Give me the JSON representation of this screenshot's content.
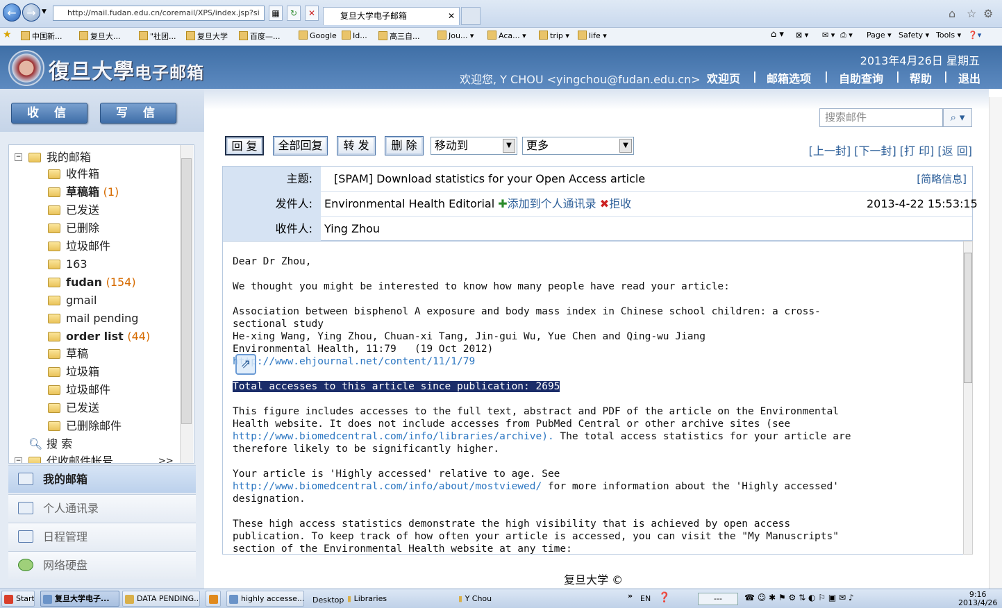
{
  "browser": {
    "address": "http://mail.fudan.edu.cn/coremail/XPS/index.jsp?si",
    "tab_title": "复旦大学电子邮箱",
    "favorites": [
      "中国新...",
      "复旦大...",
      "\"社团...",
      "复旦大学",
      "百度—...",
      "Google",
      "Id...",
      "高三自...",
      "Jou...",
      "Aca...",
      "trip",
      "life"
    ],
    "commands": [
      "Page",
      "Safety",
      "Tools"
    ]
  },
  "mail_header": {
    "logo_title": "復旦大學",
    "logo_sub": "电子邮箱",
    "date": "2013年4月26日 星期五",
    "welcome": "欢迎您, Y CHOU <yingchou@fudan.edu.cn>",
    "nav": [
      "欢迎页",
      "邮箱选项",
      "自助查询",
      "帮助",
      "退出"
    ]
  },
  "left": {
    "receive": "收 信",
    "compose": "写 信",
    "tree_root": "我的邮箱",
    "folders": [
      {
        "name": "收件箱",
        "count": ""
      },
      {
        "name": "草稿箱",
        "count": "(1)"
      },
      {
        "name": "已发送",
        "count": ""
      },
      {
        "name": "已删除",
        "count": ""
      },
      {
        "name": "垃圾邮件",
        "count": ""
      },
      {
        "name": "163",
        "count": ""
      },
      {
        "name": "fudan",
        "count": "(154)"
      },
      {
        "name": "gmail",
        "count": ""
      },
      {
        "name": "mail pending",
        "count": ""
      },
      {
        "name": "order list",
        "count": "(44)"
      },
      {
        "name": "草稿",
        "count": ""
      },
      {
        "name": "垃圾箱",
        "count": ""
      },
      {
        "name": "垃圾邮件",
        "count": ""
      },
      {
        "name": "已发送",
        "count": ""
      },
      {
        "name": "已删除邮件",
        "count": ""
      }
    ],
    "search": "搜 索",
    "proxy": "代收邮件帐号",
    "proxy_more": ">>",
    "modules": [
      "我的邮箱",
      "个人通讯录",
      "日程管理",
      "网络硬盘"
    ]
  },
  "toolbar": {
    "search_placeholder": "搜索邮件",
    "reply": "回 复",
    "reply_all": "全部回复",
    "forward": "转 发",
    "delete": "删 除",
    "move_to": "移动到",
    "more": "更多",
    "nav_links": "[上一封] [下一封] [打 印] [返 回]"
  },
  "message": {
    "subject_label": "主题:",
    "subject": "[SPAM] Download statistics for your Open Access article",
    "brief_info": "[简略信息]",
    "from_label": "发件人:",
    "from": "Environmental Health Editorial",
    "add_contact": "添加到个人通讯录",
    "reject": "拒收",
    "date": "2013-4-22 15:53:15",
    "to_label": "收件人:",
    "to": "Ying Zhou",
    "body": {
      "greeting": "Dear Dr Zhou,",
      "p1": "We thought you might be interested to know how many people have read your article:",
      "article_l1": "Association between bisphenol A exposure and body mass index in Chinese school children: a cross-",
      "article_l2": "sectional study",
      "authors": "He-xing Wang, Ying Zhou, Chuan-xi Tang, Jin-gui Wu, Yue Chen and Qing-wu Jiang",
      "journal": "Environmental Health, 11:79   (19 Oct 2012)",
      "url": "http://www.ehjournal.net/content/11/1/79",
      "total": "Total accesses to this article since publication: 2695",
      "p2_l1": "This figure includes accesses to the full text, abstract and PDF of the article on the Environmental",
      "p2_l2": "Health website. It does not include accesses from PubMed Central or other archive sites (see",
      "p2_link": "http://www.biomedcentral.com/info/libraries/archive).",
      "p2_l3b": " The total access statistics for your article are",
      "p2_l4": "therefore likely to be significantly higher.",
      "p3_l1": "Your article is 'Highly accessed' relative to age. See",
      "p3_link": "http://www.biomedcentral.com/info/about/mostviewed/",
      "p3_l2b": " for more information about the 'Highly accessed'",
      "p3_l3": "designation.",
      "p4_l1": "These high access statistics demonstrate the high visibility that is achieved by open access",
      "p4_l2": "publication. To keep track of how often your article is accessed, you can visit the \"My Manuscripts\"",
      "p4_l3": "section of the Environmental Health website at any time:"
    }
  },
  "footer": "复旦大学 ©",
  "taskbar": {
    "start": "Start",
    "tasks": [
      "复旦大学电子...",
      "DATA PENDING...",
      "highly accesse..."
    ],
    "desktop": "Desktop",
    "libraries": "Libraries",
    "user": "Y Chou",
    "lang": "EN",
    "time": "9:16",
    "date": "2013/4/26"
  }
}
